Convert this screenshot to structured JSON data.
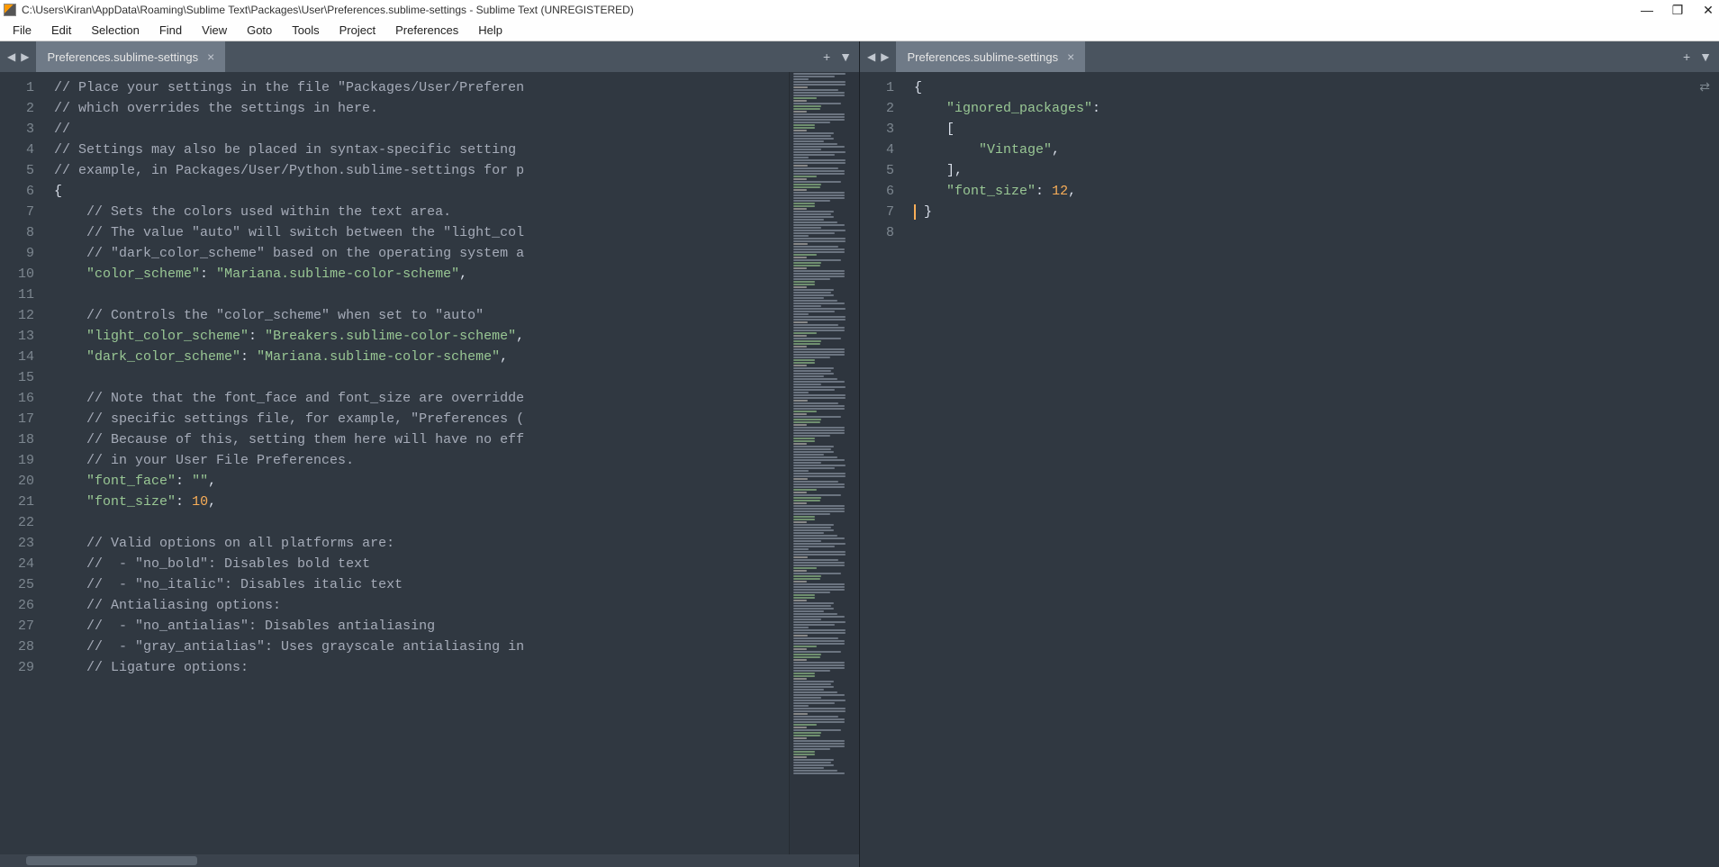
{
  "window": {
    "title": "C:\\Users\\Kiran\\AppData\\Roaming\\Sublime Text\\Packages\\User\\Preferences.sublime-settings - Sublime Text (UNREGISTERED)"
  },
  "win_controls": {
    "min": "—",
    "max": "❐",
    "close": "✕"
  },
  "menu": [
    "File",
    "Edit",
    "Selection",
    "Find",
    "View",
    "Goto",
    "Tools",
    "Project",
    "Preferences",
    "Help"
  ],
  "panes": {
    "left": {
      "tab_title": "Preferences.sublime-settings",
      "tab_close": "×",
      "nav_prev": "◀",
      "nav_next": "▶",
      "new_tab": "+",
      "dropdown": "▼",
      "line_count": 29,
      "hscroll": {
        "left_pct": 3,
        "width_pct": 20
      },
      "lines": [
        [
          {
            "c": "cm",
            "t": "// Place your settings in the file \"Packages/User/Preferen"
          }
        ],
        [
          {
            "c": "cm",
            "t": "// which overrides the settings in here."
          }
        ],
        [
          {
            "c": "cm",
            "t": "//"
          }
        ],
        [
          {
            "c": "cm",
            "t": "// Settings may also be placed in syntax-specific setting "
          }
        ],
        [
          {
            "c": "cm",
            "t": "// example, in Packages/User/Python.sublime-settings for p"
          }
        ],
        [
          {
            "c": "pun",
            "t": "{"
          }
        ],
        [
          {
            "c": "pun",
            "t": "    "
          },
          {
            "c": "cm",
            "t": "// Sets the colors used within the text area."
          }
        ],
        [
          {
            "c": "pun",
            "t": "    "
          },
          {
            "c": "cm",
            "t": "// The value \"auto\" will switch between the \"light_col"
          }
        ],
        [
          {
            "c": "pun",
            "t": "    "
          },
          {
            "c": "cm",
            "t": "// \"dark_color_scheme\" based on the operating system a"
          }
        ],
        [
          {
            "c": "pun",
            "t": "    "
          },
          {
            "c": "key",
            "t": "\"color_scheme\""
          },
          {
            "c": "pun",
            "t": ": "
          },
          {
            "c": "str",
            "t": "\"Mariana.sublime-color-scheme\""
          },
          {
            "c": "pun",
            "t": ","
          }
        ],
        [
          {
            "c": "pun",
            "t": ""
          }
        ],
        [
          {
            "c": "pun",
            "t": "    "
          },
          {
            "c": "cm",
            "t": "// Controls the \"color_scheme\" when set to \"auto\""
          }
        ],
        [
          {
            "c": "pun",
            "t": "    "
          },
          {
            "c": "key",
            "t": "\"light_color_scheme\""
          },
          {
            "c": "pun",
            "t": ": "
          },
          {
            "c": "str",
            "t": "\"Breakers.sublime-color-scheme\""
          },
          {
            "c": "pun",
            "t": ","
          }
        ],
        [
          {
            "c": "pun",
            "t": "    "
          },
          {
            "c": "key",
            "t": "\"dark_color_scheme\""
          },
          {
            "c": "pun",
            "t": ": "
          },
          {
            "c": "str",
            "t": "\"Mariana.sublime-color-scheme\""
          },
          {
            "c": "pun",
            "t": ","
          }
        ],
        [
          {
            "c": "pun",
            "t": ""
          }
        ],
        [
          {
            "c": "pun",
            "t": "    "
          },
          {
            "c": "cm",
            "t": "// Note that the font_face and font_size are overridde"
          }
        ],
        [
          {
            "c": "pun",
            "t": "    "
          },
          {
            "c": "cm",
            "t": "// specific settings file, for example, \"Preferences ("
          }
        ],
        [
          {
            "c": "pun",
            "t": "    "
          },
          {
            "c": "cm",
            "t": "// Because of this, setting them here will have no eff"
          }
        ],
        [
          {
            "c": "pun",
            "t": "    "
          },
          {
            "c": "cm",
            "t": "// in your User File Preferences."
          }
        ],
        [
          {
            "c": "pun",
            "t": "    "
          },
          {
            "c": "key",
            "t": "\"font_face\""
          },
          {
            "c": "pun",
            "t": ": "
          },
          {
            "c": "str",
            "t": "\"\""
          },
          {
            "c": "pun",
            "t": ","
          }
        ],
        [
          {
            "c": "pun",
            "t": "    "
          },
          {
            "c": "key",
            "t": "\"font_size\""
          },
          {
            "c": "pun",
            "t": ": "
          },
          {
            "c": "num",
            "t": "10"
          },
          {
            "c": "pun",
            "t": ","
          }
        ],
        [
          {
            "c": "pun",
            "t": ""
          }
        ],
        [
          {
            "c": "pun",
            "t": "    "
          },
          {
            "c": "cm",
            "t": "// Valid options on all platforms are:"
          }
        ],
        [
          {
            "c": "pun",
            "t": "    "
          },
          {
            "c": "cm",
            "t": "//  - \"no_bold\": Disables bold text"
          }
        ],
        [
          {
            "c": "pun",
            "t": "    "
          },
          {
            "c": "cm",
            "t": "//  - \"no_italic\": Disables italic text"
          }
        ],
        [
          {
            "c": "pun",
            "t": "    "
          },
          {
            "c": "cm",
            "t": "// Antialiasing options:"
          }
        ],
        [
          {
            "c": "pun",
            "t": "    "
          },
          {
            "c": "cm",
            "t": "//  - \"no_antialias\": Disables antialiasing"
          }
        ],
        [
          {
            "c": "pun",
            "t": "    "
          },
          {
            "c": "cm",
            "t": "//  - \"gray_antialias\": Uses grayscale antialiasing in"
          }
        ],
        [
          {
            "c": "pun",
            "t": "    "
          },
          {
            "c": "cm",
            "t": "// Ligature options:"
          }
        ]
      ]
    },
    "right": {
      "tab_title": "Preferences.sublime-settings",
      "tab_close": "×",
      "nav_prev": "◀",
      "nav_next": "▶",
      "new_tab": "+",
      "dropdown": "▼",
      "switch_icon": "⇄",
      "line_count": 8,
      "lines": [
        [
          {
            "c": "pun",
            "t": "{"
          }
        ],
        [
          {
            "c": "pun",
            "t": "    "
          },
          {
            "c": "key",
            "t": "\"ignored_packages\""
          },
          {
            "c": "pun",
            "t": ":"
          }
        ],
        [
          {
            "c": "pun",
            "t": "    ["
          }
        ],
        [
          {
            "c": "pun",
            "t": "        "
          },
          {
            "c": "str",
            "t": "\"Vintage\""
          },
          {
            "c": "pun",
            "t": ","
          }
        ],
        [
          {
            "c": "pun",
            "t": "    ],"
          }
        ],
        [
          {
            "c": "pun",
            "t": "    "
          },
          {
            "c": "key",
            "t": "\"font_size\""
          },
          {
            "c": "pun",
            "t": ": "
          },
          {
            "c": "num",
            "t": "12"
          },
          {
            "c": "pun",
            "t": ","
          }
        ],
        [
          {
            "c": "pun",
            "t": "}"
          }
        ],
        [
          {
            "c": "pun",
            "t": ""
          }
        ]
      ],
      "cursor_line": 7
    }
  }
}
